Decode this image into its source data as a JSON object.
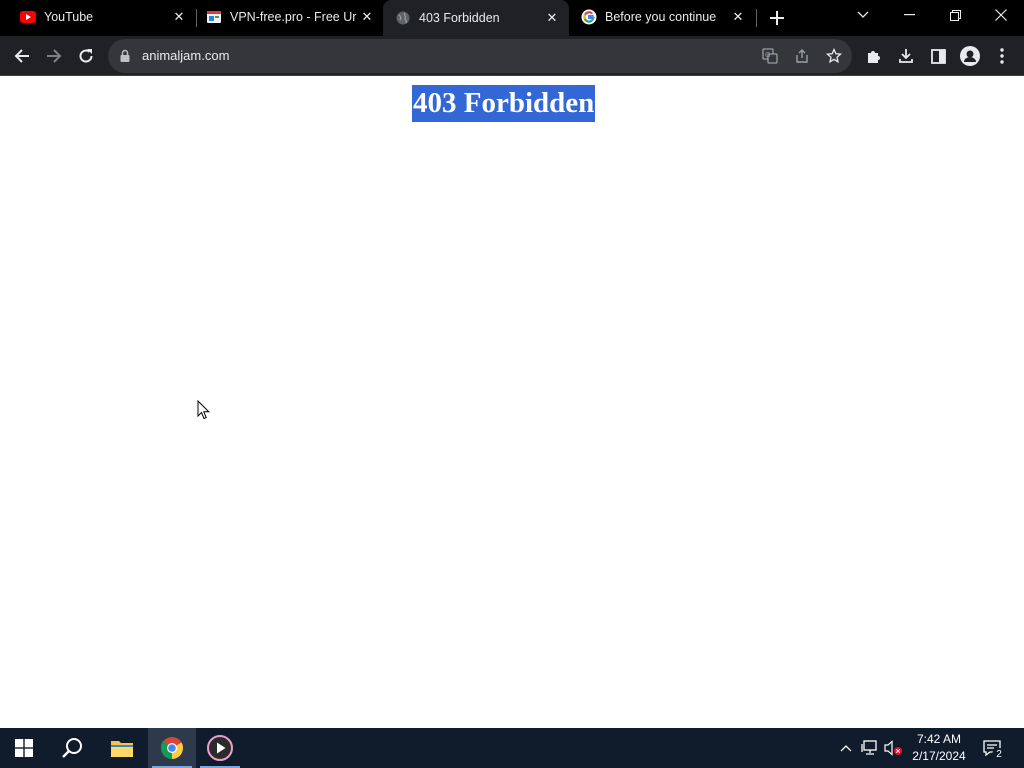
{
  "browser": {
    "tabs": [
      {
        "title": "YouTube",
        "icon": "youtube-icon",
        "active": false
      },
      {
        "title": "VPN-free.pro - Free Ur",
        "icon": "vpn-site-icon",
        "active": false
      },
      {
        "title": "403 Forbidden",
        "icon": "globe-icon",
        "active": true
      },
      {
        "title": "Before you continue",
        "icon": "google-icon",
        "active": false
      }
    ],
    "address": "animaljam.com"
  },
  "page": {
    "heading": "403 Forbidden"
  },
  "taskbar": {
    "time": "7:42 AM",
    "date": "2/17/2024",
    "notification_count": "2"
  },
  "colors": {
    "selection_highlight": "#3367d6",
    "tabstrip_bg": "#000000",
    "toolbar_bg": "#202124",
    "taskbar_bg": "#101c2b"
  }
}
